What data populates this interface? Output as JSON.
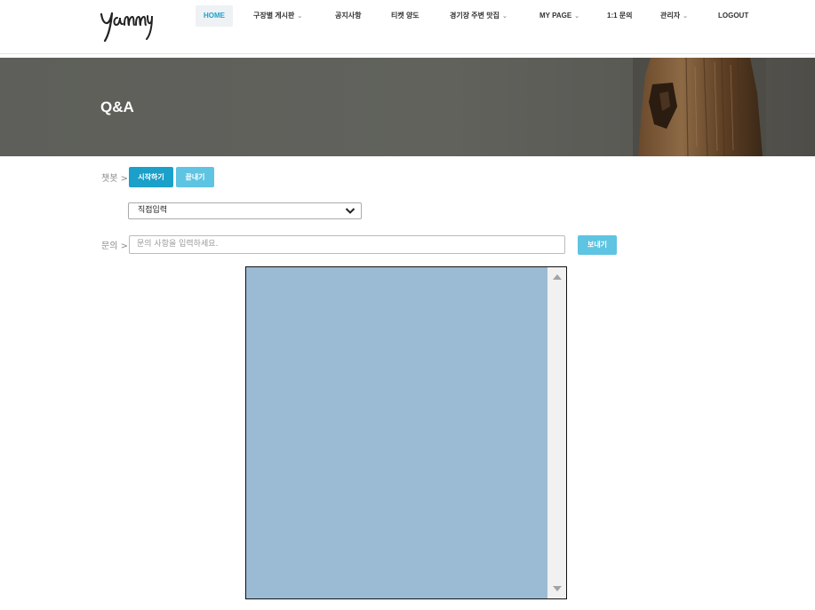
{
  "brand": {
    "logo_text": "yammy"
  },
  "nav": {
    "items": [
      {
        "label": "HOME",
        "active": true,
        "dropdown": false
      },
      {
        "label": "구장별 게시판",
        "active": false,
        "dropdown": true
      },
      {
        "label": "공지사항",
        "active": false,
        "dropdown": false
      },
      {
        "label": "티켓 양도",
        "active": false,
        "dropdown": false
      },
      {
        "label": "경기장 주변 맛집",
        "active": false,
        "dropdown": true
      },
      {
        "label": "MY PAGE",
        "active": false,
        "dropdown": true
      },
      {
        "label": "1:1 문의",
        "active": false,
        "dropdown": false
      },
      {
        "label": "관리자",
        "active": false,
        "dropdown": true
      },
      {
        "label": "LOGOUT",
        "active": false,
        "dropdown": false
      }
    ]
  },
  "banner": {
    "title": "Q&A"
  },
  "chatbot": {
    "label": "챗봇 >",
    "start_label": "시작하기",
    "end_label": "끝내기"
  },
  "select": {
    "selected": "직접입력"
  },
  "inquiry": {
    "label": "문의 >",
    "placeholder": "문의 사항을 입력하세요.",
    "send_label": "보내기"
  },
  "colors": {
    "accent": "#1aa0c9",
    "accent_light": "#5ec4e2",
    "chat_bg": "#9bbbd4",
    "banner_bg": "#5e5f5a"
  }
}
